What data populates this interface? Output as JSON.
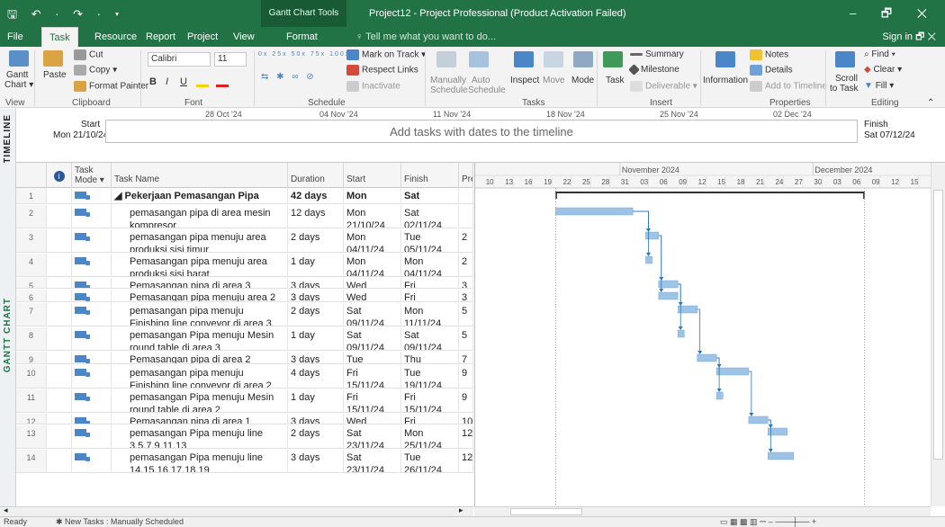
{
  "app": {
    "quick_access": "🖫 ↶ · ↷ · ▾",
    "context_group": "Gantt Chart Tools",
    "title": "Project12 - Project Professional (Product Activation Failed)",
    "window_controls": "–  🗗  ✕"
  },
  "tabs": [
    {
      "label": "File",
      "active": false
    },
    {
      "label": "Task",
      "active": true
    },
    {
      "label": "Resource",
      "active": false
    },
    {
      "label": "Report",
      "active": false
    },
    {
      "label": "Project",
      "active": false
    },
    {
      "label": "View",
      "active": false
    },
    {
      "label": "Format",
      "active": false
    }
  ],
  "tell_me": "♀ Tell me what you want to do...",
  "sign_in": "Sign in   🗗  ✕",
  "ribbon": {
    "view": {
      "gantt": "Gantt",
      "chart": "Chart ▾",
      "group": "View"
    },
    "clipboard": {
      "paste": "Paste",
      "cut": "Cut",
      "copy": "Copy ▾",
      "format_painter": "Format Painter",
      "group": "Clipboard"
    },
    "font": {
      "name": "Calibri",
      "size": "11",
      "bold": "B",
      "italic": "I",
      "underline": "U",
      "group": "Font"
    },
    "schedule": {
      "mark_on_track": "Mark on Track ▾",
      "respect_links": "Respect Links",
      "inactivate": "Inactivate",
      "group": "Schedule",
      "percents": [
        "0x",
        "25x",
        "50x",
        "75x",
        "100x"
      ]
    },
    "tasks": {
      "manually": "Manually",
      "schedule": "Schedule",
      "auto": "Auto",
      "schedule2": "Schedule",
      "inspect": "Inspect",
      "move": "Move",
      "mode": "Mode",
      "group": "Tasks"
    },
    "insert": {
      "task": "Task",
      "summary": "Summary",
      "milestone": "Milestone",
      "deliverable": "Deliverable ▾",
      "group": "Insert"
    },
    "properties": {
      "information": "Information",
      "notes": "Notes",
      "details": "Details",
      "add_to_timeline": "Add to Timeline",
      "group": "Properties"
    },
    "editing": {
      "scroll": "Scroll",
      "to_task": "to Task",
      "find": "Find ▾",
      "clear": "Clear ▾",
      "fill": "Fill ▾",
      "group": "Editing"
    }
  },
  "timeline": {
    "side_label": "TIMELINE",
    "start_label": "Start",
    "start_date": "Mon 21/10/24",
    "finish_label": "Finish",
    "finish_date": "Sat 07/12/24",
    "placeholder": "Add tasks with dates to the timeline",
    "dates": [
      "28 Oct '24",
      "04 Nov '24",
      "11 Nov '24",
      "18 Nov '24",
      "25 Nov '24",
      "02 Dec '24"
    ]
  },
  "side_label": "GANTT CHART",
  "columns": {
    "mode": "Task Mode ▾",
    "name": "Task Name",
    "duration": "Duration",
    "start": "Start",
    "finish": "Finish",
    "pred": "Pre"
  },
  "tasks": [
    {
      "id": "1",
      "name": "◢ Pekerjaan Pemasangan Pipa",
      "duration": "42 days",
      "start": "Mon 21/10/2",
      "finish": "Sat 07/12/24",
      "pred": "",
      "summary": true
    },
    {
      "id": "2",
      "name": "pemasangan pipa di area mesin kompresor",
      "duration": "12 days",
      "start": "Mon 21/10/24",
      "finish": "Sat 02/11/24",
      "pred": ""
    },
    {
      "id": "3",
      "name": "pemasangan pipa menuju area produksi sisi timur",
      "duration": "2 days",
      "start": "Mon 04/11/24",
      "finish": "Tue 05/11/24",
      "pred": "2"
    },
    {
      "id": "4",
      "name": "Pemasangan pipa menuju area produksi sisi barat",
      "duration": "1 day",
      "start": "Mon 04/11/24",
      "finish": "Mon 04/11/24",
      "pred": "2"
    },
    {
      "id": "5",
      "name": "Pemasangan pipa di area 3",
      "duration": "3 days",
      "start": "Wed 06/11/2",
      "finish": "Fri 08/11/24",
      "pred": "3"
    },
    {
      "id": "6",
      "name": "Pemasangan pipa menuju area 2",
      "duration": "3 days",
      "start": "Wed 06/11/2",
      "finish": "Fri 08/11/24",
      "pred": "3"
    },
    {
      "id": "7",
      "name": "pemasangan pipa menuju Finishing line conveyor di area 3",
      "duration": "2 days",
      "start": "Sat 09/11/24",
      "finish": "Mon 11/11/24",
      "pred": "5"
    },
    {
      "id": "8",
      "name": "pemasangan Pipa menuju Mesin round table di area 3",
      "duration": "1 day",
      "start": "Sat 09/11/24",
      "finish": "Sat 09/11/24",
      "pred": "5"
    },
    {
      "id": "9",
      "name": "Pemasangan pipa di area 2",
      "duration": "3 days",
      "start": "Tue 12/11/24",
      "finish": "Thu 14/11/24",
      "pred": "7"
    },
    {
      "id": "10",
      "name": "pemasangan pipa menuju Finishing line conveyor di area 2",
      "duration": "4 days",
      "start": "Fri 15/11/24",
      "finish": "Tue 19/11/24",
      "pred": "9"
    },
    {
      "id": "11",
      "name": "pemasangan Pipa menuju Mesin round table di area 2",
      "duration": "1 day",
      "start": "Fri 15/11/24",
      "finish": "Fri 15/11/24",
      "pred": "9"
    },
    {
      "id": "12",
      "name": "Pemasangan pipa di area 1",
      "duration": "3 days",
      "start": "Wed 20/11/24",
      "finish": "Fri 22/11/24",
      "pred": "10"
    },
    {
      "id": "13",
      "name": "pemasangan Pipa menuju line 3,5,7,9,11,13",
      "duration": "2 days",
      "start": "Sat 23/11/24",
      "finish": "Mon 25/11/24",
      "pred": "12"
    },
    {
      "id": "14",
      "name": "pemasangan Pipa menuju line 14,15,16,17,18,19",
      "duration": "3 days",
      "start": "Sat 23/11/24",
      "finish": "Tue 26/11/24",
      "pred": "12"
    }
  ],
  "gantt": {
    "month_labels": [
      {
        "label": "November 2024",
        "day": 31
      },
      {
        "label": "December 2024",
        "day": 61
      }
    ],
    "day_ticks": [
      {
        "label": "10",
        "day": 10
      },
      {
        "label": "13",
        "day": 13
      },
      {
        "label": "16",
        "day": 16
      },
      {
        "label": "19",
        "day": 19
      },
      {
        "label": "22",
        "day": 22
      },
      {
        "label": "25",
        "day": 25
      },
      {
        "label": "28",
        "day": 28
      },
      {
        "label": "31",
        "day": 31
      },
      {
        "label": "03",
        "day": 34
      },
      {
        "label": "06",
        "day": 37
      },
      {
        "label": "09",
        "day": 40
      },
      {
        "label": "12",
        "day": 43
      },
      {
        "label": "15",
        "day": 46
      },
      {
        "label": "18",
        "day": 49
      },
      {
        "label": "21",
        "day": 52
      },
      {
        "label": "24",
        "day": 55
      },
      {
        "label": "27",
        "day": 58
      },
      {
        "label": "30",
        "day": 61
      },
      {
        "label": "03",
        "day": 64
      },
      {
        "label": "06",
        "day": 67
      },
      {
        "label": "09",
        "day": 70
      },
      {
        "label": "12",
        "day": 73
      },
      {
        "label": "15",
        "day": 76
      }
    ],
    "bars": [
      {
        "task": "1",
        "start": 21,
        "end": 69,
        "summary": true
      },
      {
        "task": "2",
        "start": 21,
        "end": 33
      },
      {
        "task": "3",
        "start": 35,
        "end": 37
      },
      {
        "task": "4",
        "start": 35,
        "end": 36
      },
      {
        "task": "5",
        "start": 37,
        "end": 40
      },
      {
        "task": "6",
        "start": 37,
        "end": 40
      },
      {
        "task": "7",
        "start": 40,
        "end": 43
      },
      {
        "task": "8",
        "start": 40,
        "end": 41
      },
      {
        "task": "9",
        "start": 43,
        "end": 46
      },
      {
        "task": "10",
        "start": 46,
        "end": 51
      },
      {
        "task": "11",
        "start": 46,
        "end": 47
      },
      {
        "task": "12",
        "start": 51,
        "end": 54
      },
      {
        "task": "13",
        "start": 54,
        "end": 57
      },
      {
        "task": "14",
        "start": 54,
        "end": 58
      }
    ],
    "links": [
      [
        "2",
        "3"
      ],
      [
        "2",
        "4"
      ],
      [
        "3",
        "5"
      ],
      [
        "3",
        "6"
      ],
      [
        "5",
        "7"
      ],
      [
        "5",
        "8"
      ],
      [
        "7",
        "9"
      ],
      [
        "9",
        "10"
      ],
      [
        "9",
        "11"
      ],
      [
        "10",
        "12"
      ],
      [
        "12",
        "13"
      ],
      [
        "12",
        "14"
      ]
    ]
  },
  "status": {
    "ready": "Ready",
    "new_tasks": "✱ New Tasks : Manually Scheduled",
    "zoom": "▭  ▦  ▩  ▥  ⎓  –  ───┼──  +"
  }
}
